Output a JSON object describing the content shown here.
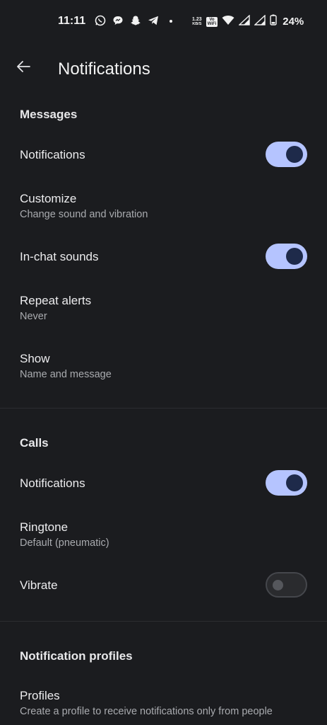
{
  "status_bar": {
    "time": "11:11",
    "net_speed_value": "1.23",
    "net_speed_unit": "KB/S",
    "wifi_badge_top": "Vo",
    "wifi_badge_bottom": "WiFi",
    "battery": "24%"
  },
  "header": {
    "title": "Notifications"
  },
  "messages": {
    "header": "Messages",
    "notifications": {
      "title": "Notifications",
      "enabled": true
    },
    "customize": {
      "title": "Customize",
      "subtitle": "Change sound and vibration"
    },
    "in_chat_sounds": {
      "title": "In-chat sounds",
      "enabled": true
    },
    "repeat_alerts": {
      "title": "Repeat alerts",
      "subtitle": "Never"
    },
    "show": {
      "title": "Show",
      "subtitle": "Name and message"
    }
  },
  "calls": {
    "header": "Calls",
    "notifications": {
      "title": "Notifications",
      "enabled": true
    },
    "ringtone": {
      "title": "Ringtone",
      "subtitle": "Default (pneumatic)"
    },
    "vibrate": {
      "title": "Vibrate",
      "enabled": false
    }
  },
  "profiles": {
    "header": "Notification profiles",
    "profiles": {
      "title": "Profiles",
      "subtitle": "Create a profile to receive notifications only from people"
    }
  },
  "colors": {
    "background": "#1b1c1f",
    "toggle_on": "#b5c4ff",
    "toggle_knob_on": "#1e2a4a"
  }
}
